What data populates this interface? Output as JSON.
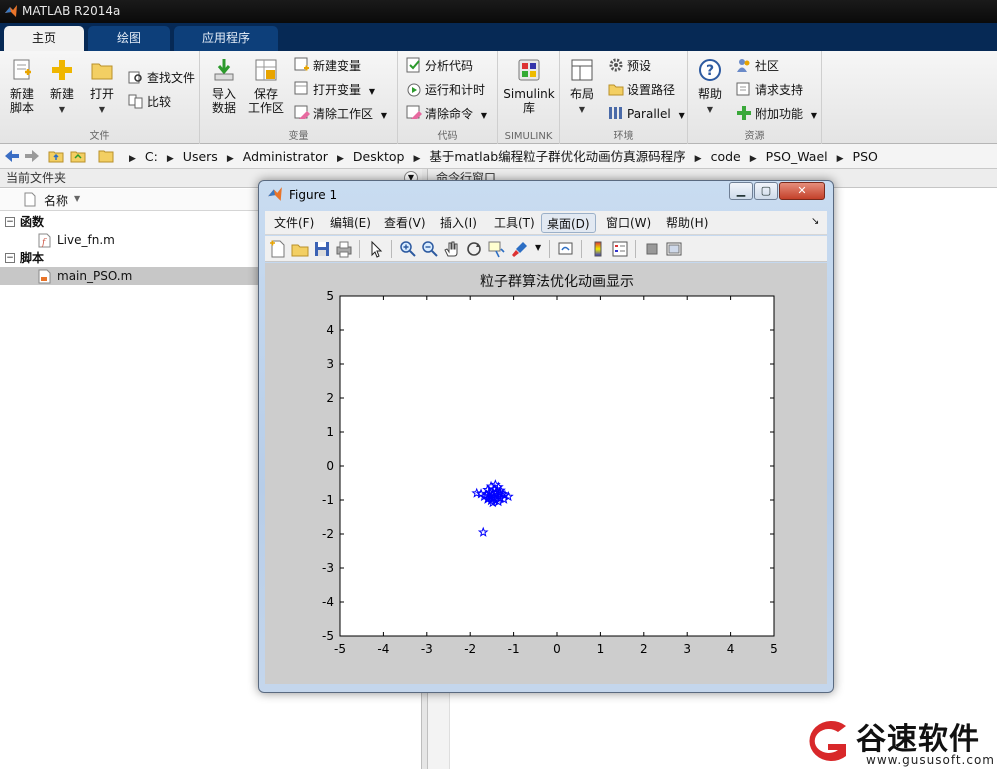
{
  "app": {
    "title": "MATLAB R2014a"
  },
  "tabs": [
    {
      "label": "主页"
    },
    {
      "label": "绘图"
    },
    {
      "label": "应用程序"
    }
  ],
  "ribbon": {
    "file": {
      "group_label": "文件",
      "new_script": "新建\n脚本",
      "new": "新建",
      "open": "打开",
      "find_files": "查找文件",
      "compare": "比较"
    },
    "variable": {
      "group_label": "变量",
      "import": "导入\n数据",
      "save_ws": "保存\n工作区",
      "new_var": "新建变量",
      "open_var": "打开变量",
      "clear_ws": "清除工作区"
    },
    "code": {
      "group_label": "代码",
      "analyze": "分析代码",
      "run_time": "运行和计时",
      "clear_cmd": "清除命令"
    },
    "simulink": {
      "group_label": "SIMULINK",
      "lib": "Simulink\n库"
    },
    "env": {
      "group_label": "环境",
      "layout": "布局",
      "prefs": "预设",
      "set_path": "设置路径",
      "parallel": "Parallel"
    },
    "resources": {
      "group_label": "资源",
      "help": "帮助",
      "community": "社区",
      "support": "请求支持",
      "addons": "附加功能"
    }
  },
  "address": {
    "path": [
      "C:",
      "Users",
      "Administrator",
      "Desktop",
      "基于matlab编程粒子群优化动画仿真源码程序",
      "code",
      "PSO_Wael",
      "PSO"
    ]
  },
  "current_folder": {
    "title": "当前文件夹",
    "column_name": "名称",
    "groups": [
      {
        "label": "函数",
        "files": [
          "Live_fn.m"
        ]
      },
      {
        "label": "脚本",
        "files": [
          "main_PSO.m"
        ]
      }
    ]
  },
  "command_window": {
    "title": "命令行窗口"
  },
  "figure": {
    "title": "Figure 1",
    "menus": [
      "文件(F)",
      "编辑(E)",
      "查看(V)",
      "插入(I)",
      "工具(T)",
      "桌面(D)",
      "窗口(W)",
      "帮助(H)"
    ],
    "highlighted_menu": "桌面(D)"
  },
  "chart_data": {
    "type": "scatter",
    "title": "粒子群算法优化动画显示",
    "xlabel": "",
    "ylabel": "",
    "xlim": [
      -5,
      5
    ],
    "ylim": [
      -5,
      5
    ],
    "xticks": [
      "-5",
      "-4",
      "-3",
      "-2",
      "-1",
      "0",
      "1",
      "2",
      "3",
      "4",
      "5"
    ],
    "yticks": [
      "5",
      "4",
      "3",
      "2",
      "1",
      "0",
      "-1",
      "-2",
      "-3",
      "-4",
      "-5"
    ],
    "grid": false,
    "marker": "pentagram",
    "marker_color": "#0000ff",
    "points": [
      [
        -1.42,
        -0.55
      ],
      [
        -1.52,
        -0.6
      ],
      [
        -1.35,
        -0.62
      ],
      [
        -1.6,
        -0.7
      ],
      [
        -1.45,
        -0.68
      ],
      [
        -1.3,
        -0.72
      ],
      [
        -1.55,
        -0.78
      ],
      [
        -1.4,
        -0.8
      ],
      [
        -1.25,
        -0.82
      ],
      [
        -1.62,
        -0.85
      ],
      [
        -1.5,
        -0.85
      ],
      [
        -1.36,
        -0.88
      ],
      [
        -1.2,
        -0.86
      ],
      [
        -1.75,
        -0.82
      ],
      [
        -1.85,
        -0.8
      ],
      [
        -1.12,
        -0.9
      ],
      [
        -1.45,
        -0.92
      ],
      [
        -1.58,
        -0.95
      ],
      [
        -1.3,
        -0.95
      ],
      [
        -1.68,
        -0.9
      ],
      [
        -1.42,
        -1.0
      ],
      [
        -1.52,
        -1.02
      ],
      [
        -1.35,
        -1.05
      ],
      [
        -1.6,
        -0.98
      ],
      [
        -1.48,
        -1.08
      ],
      [
        -1.22,
        -0.98
      ],
      [
        -1.4,
        -0.75
      ],
      [
        -1.55,
        -0.88
      ],
      [
        -1.33,
        -0.78
      ],
      [
        -1.47,
        -0.96
      ],
      [
        -1.7,
        -1.95
      ]
    ]
  },
  "watermark": {
    "name": "谷速软件",
    "url": "www.gususoft.com"
  }
}
